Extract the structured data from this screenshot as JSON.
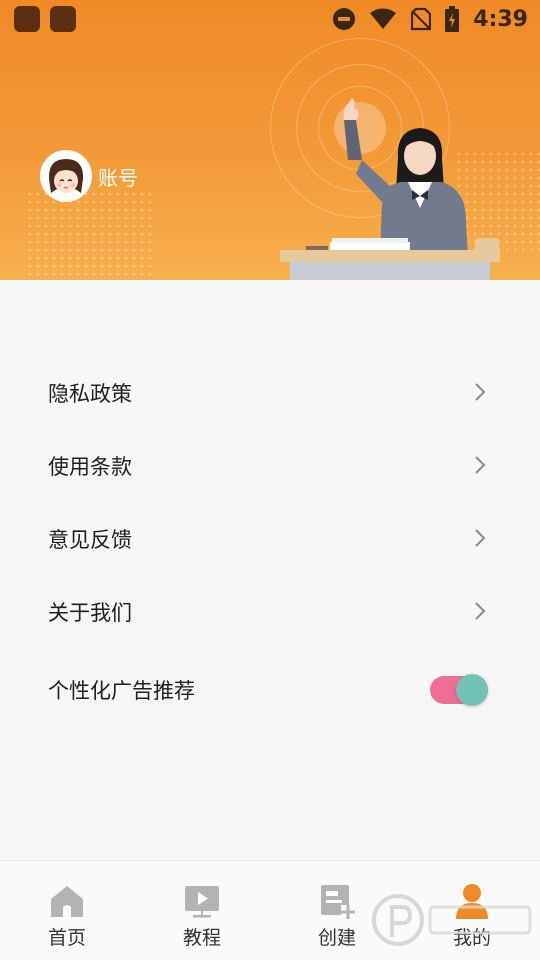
{
  "status_bar": {
    "time": "4:39",
    "icons": [
      "app-icon",
      "app-icon",
      "do-not-disturb-icon",
      "wifi-icon",
      "no-sim-icon",
      "battery-charging-icon"
    ]
  },
  "header": {
    "account_label": "账号",
    "avatar": "avatar-icon",
    "colors": {
      "gradient_top": "#f08a26",
      "gradient_bottom": "#f7b04e"
    }
  },
  "menu": {
    "items": [
      {
        "label": "隐私政策",
        "icon": "chevron-right-icon"
      },
      {
        "label": "使用条款",
        "icon": "chevron-right-icon"
      },
      {
        "label": "意见反馈",
        "icon": "chevron-right-icon"
      },
      {
        "label": "关于我们",
        "icon": "chevron-right-icon"
      }
    ],
    "toggle": {
      "label": "个性化广告推荐",
      "on": true
    }
  },
  "bottom_nav": {
    "items": [
      {
        "label": "首页",
        "icon": "home-icon",
        "active": false
      },
      {
        "label": "教程",
        "icon": "video-tutorial-icon",
        "active": false
      },
      {
        "label": "创建",
        "icon": "create-icon",
        "active": false
      },
      {
        "label": "我的",
        "icon": "profile-icon",
        "active": true
      }
    ],
    "colors": {
      "active": "#f08a26",
      "inactive": "#b3b3b3"
    }
  }
}
